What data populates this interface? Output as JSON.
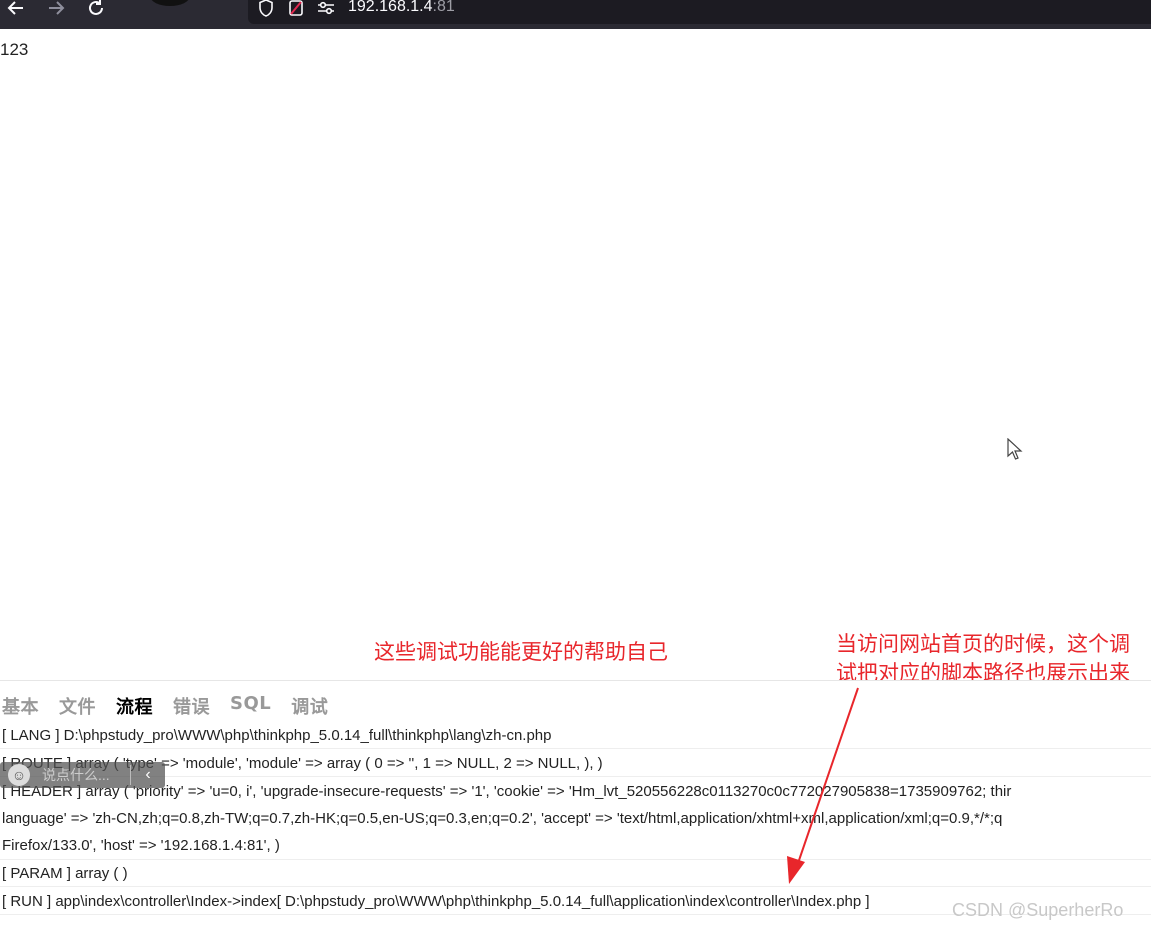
{
  "browser": {
    "url_host": "192.168.1.4",
    "url_port": ":81",
    "icons": [
      "back-arrow-icon",
      "forward-arrow-icon",
      "reload-icon",
      "shield-icon",
      "permissions-icon",
      "site-settings-icon"
    ]
  },
  "page": {
    "body_text": "123"
  },
  "annotations": {
    "left": "这些调试功能能更好的帮助自己",
    "right_line1": "当访问网站首页的时候，这个调",
    "right_line2": "试把对应的脚本路径也展示出来",
    "color": "#e8262b"
  },
  "trace": {
    "tabs": [
      "基本",
      "文件",
      "流程",
      "错误",
      "SQL",
      "调试"
    ],
    "active_tab": "流程",
    "rows": {
      "lang": "[ LANG ] D:\\phpstudy_pro\\WWW\\php\\thinkphp_5.0.14_full\\thinkphp\\lang\\zh-cn.php",
      "route": "[ ROUTE ] array ( 'type' => 'module', 'module' => array ( 0 => '', 1 => NULL, 2 => NULL, ), )",
      "header_line1": "[ HEADER ] array ( 'priority' => 'u=0, i', 'upgrade-insecure-requests' => '1', 'cookie' => 'Hm_lvt_520556228c0113270c0c772027905838=1735909762; thir",
      "header_line2": "language' => 'zh-CN,zh;q=0.8,zh-TW;q=0.7,zh-HK;q=0.5,en-US;q=0.3,en;q=0.2', 'accept' => 'text/html,application/xhtml+xml,application/xml;q=0.9,*/*;q",
      "header_line3": "Firefox/133.0', 'host' => '192.168.1.4:81', )",
      "param": "[ PARAM ] array ( )",
      "run": "[ RUN ] app\\index\\controller\\Index->index[ D:\\phpstudy_pro\\WWW\\php\\thinkphp_5.0.14_full\\application\\index\\controller\\Index.php ]"
    }
  },
  "chat": {
    "placeholder": "说点什么...",
    "collapse_glyph": "‹"
  },
  "watermark": "CSDN @SuperherRo"
}
